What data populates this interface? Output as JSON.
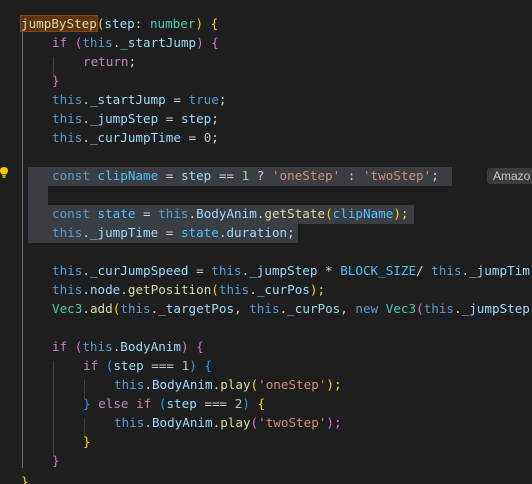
{
  "editor": {
    "lines": [
      {
        "t": [
          "jumpByStep",
          "(",
          "step",
          ": ",
          "number",
          ") ",
          "{"
        ]
      },
      {
        "t": [
          "if",
          " (",
          "this",
          ".",
          "_startJump",
          ") ",
          "{"
        ]
      },
      {
        "t": [
          "return",
          ";"
        ]
      },
      {
        "t": [
          "}"
        ]
      },
      {
        "t": [
          "this",
          ".",
          "_startJump",
          " = ",
          "true",
          ";"
        ]
      },
      {
        "t": [
          "this",
          ".",
          "_jumpStep",
          " = ",
          "step",
          ";"
        ]
      },
      {
        "t": [
          "this",
          ".",
          "_curJumpTime",
          " = ",
          "0",
          ";"
        ]
      },
      {
        "t": []
      },
      {
        "t": [
          "const",
          " ",
          "clipName",
          " = ",
          "step",
          " == ",
          "1",
          " ? ",
          "'oneStep'",
          " : ",
          "'twoStep'",
          ";"
        ]
      },
      {
        "t": []
      },
      {
        "t": [
          "const",
          " ",
          "state",
          " = ",
          "this",
          ".",
          "BodyAnim",
          ".",
          "getState",
          "(",
          "clipName",
          ");"
        ]
      },
      {
        "t": [
          "this",
          ".",
          "_jumpTime",
          " = ",
          "state",
          ".",
          "duration",
          ";"
        ]
      },
      {
        "t": []
      },
      {
        "t": [
          "this",
          ".",
          "_curJumpSpeed",
          " = ",
          "this",
          ".",
          "_jumpStep",
          " * ",
          "BLOCK_SIZE",
          "/ ",
          "this",
          ".",
          "_jumpTim"
        ]
      },
      {
        "t": [
          "this",
          ".",
          "node",
          ".",
          "getPosition",
          "(",
          "this",
          ".",
          "_curPos",
          ");"
        ]
      },
      {
        "t": [
          "Vec3",
          ".",
          "add",
          "(",
          "this",
          ".",
          "_targetPos",
          ", ",
          "this",
          ".",
          "_curPos",
          ", ",
          "new",
          " ",
          "Vec3",
          "(",
          "this",
          ".",
          "_jumpStep"
        ]
      },
      {
        "t": []
      },
      {
        "t": [
          "if",
          " (",
          "this",
          ".",
          "BodyAnim",
          ") ",
          "{"
        ]
      },
      {
        "t": [
          "if",
          " (",
          "step",
          " === ",
          "1",
          ") ",
          "{"
        ]
      },
      {
        "t": [
          "this",
          ".",
          "BodyAnim",
          ".",
          "play",
          "(",
          "'oneStep'",
          ");"
        ]
      },
      {
        "t": [
          "}",
          " ",
          "else",
          " ",
          "if",
          " (",
          "step",
          " === ",
          "2",
          ") ",
          "{"
        ]
      },
      {
        "t": [
          "this",
          ".",
          "BodyAnim",
          ".",
          "play",
          "(",
          "'twoStep'",
          ");"
        ]
      },
      {
        "t": [
          "}"
        ]
      },
      {
        "t": [
          "}"
        ]
      }
    ],
    "closing_brace": "}",
    "inline_hint": "Amazo"
  }
}
